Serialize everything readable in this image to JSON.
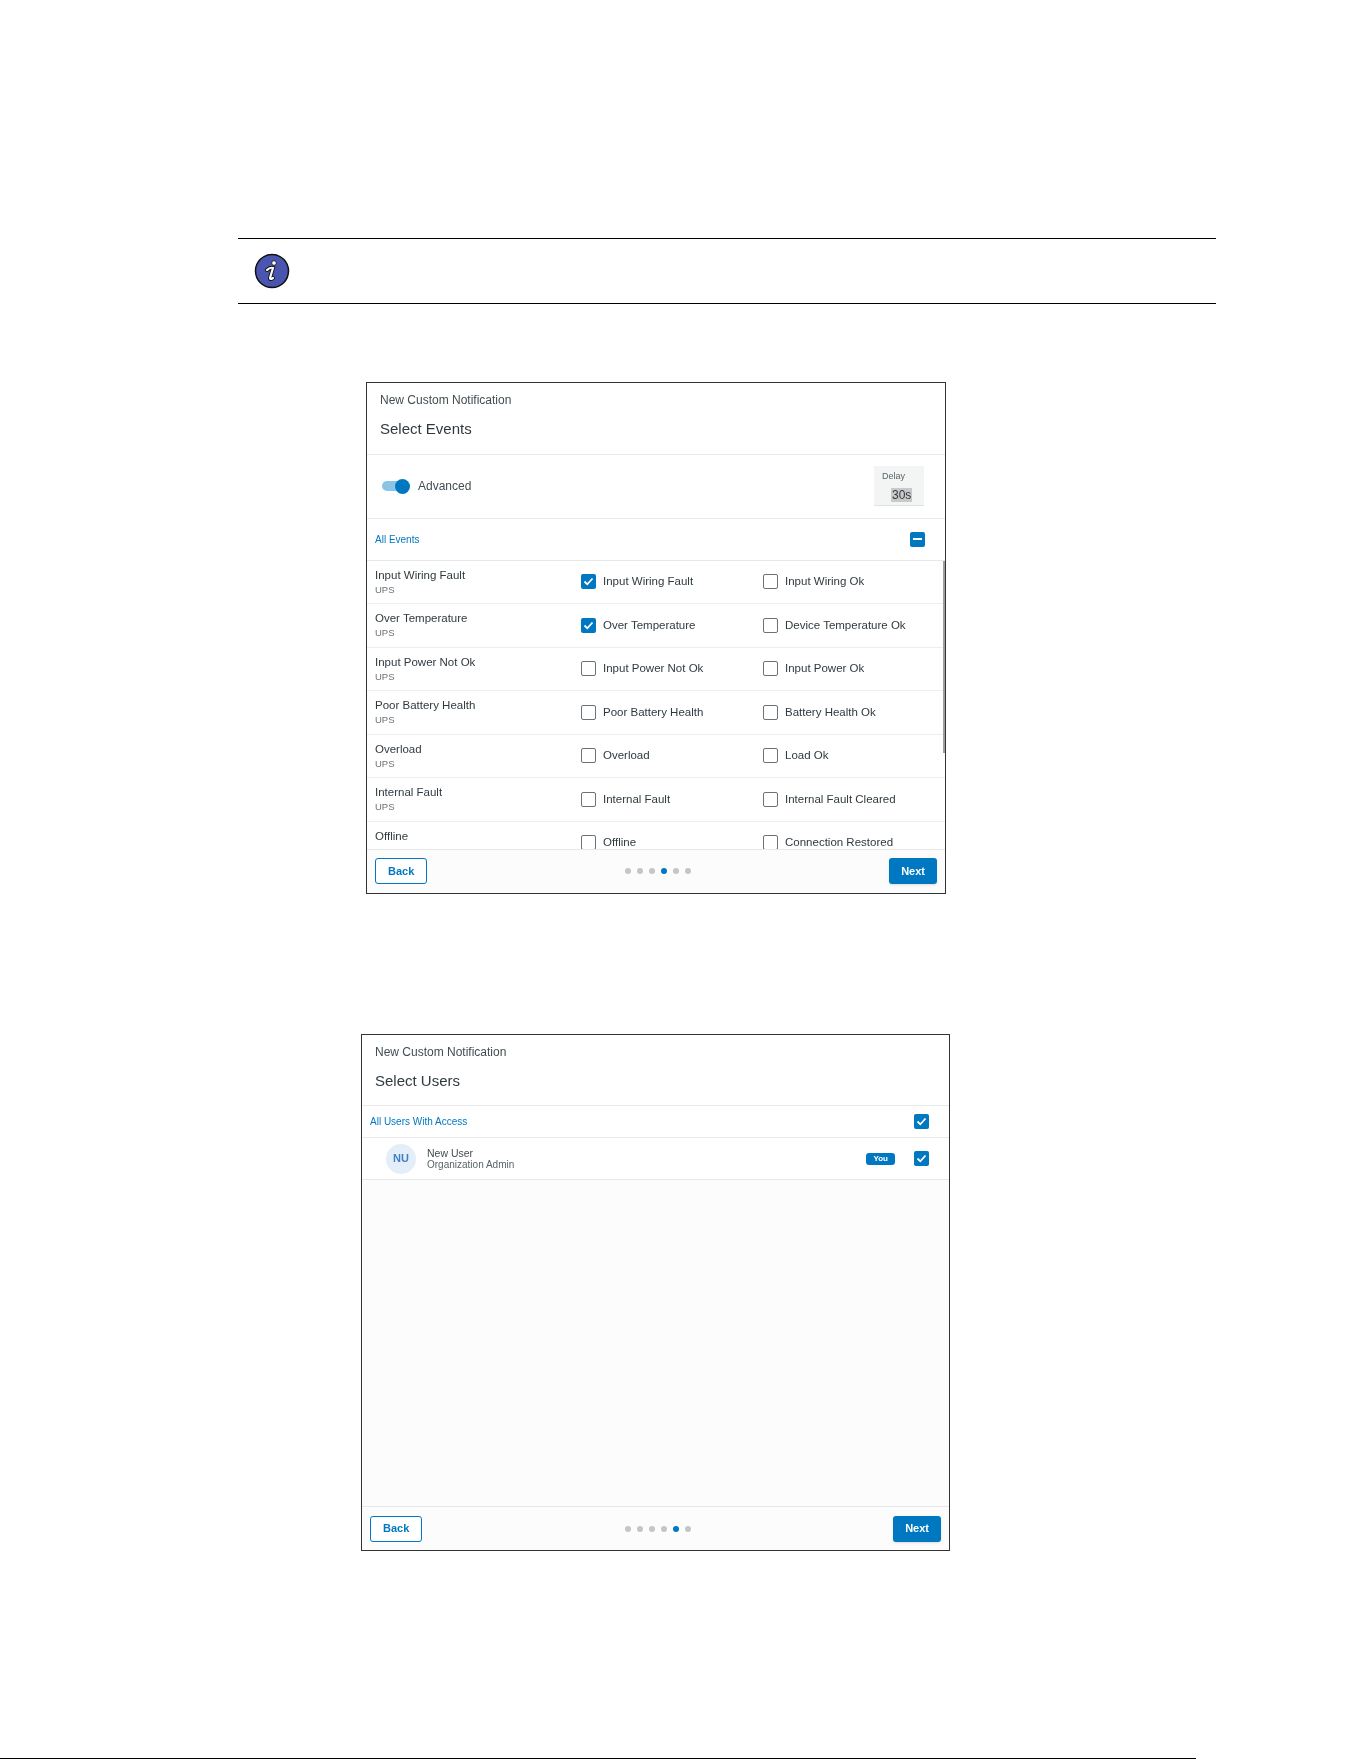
{
  "events_dialog": {
    "title": "New Custom Notification",
    "subtitle": "Select Events",
    "advanced": {
      "label": "Advanced",
      "on": true
    },
    "delay": {
      "label": "Delay",
      "value": "30s"
    },
    "all_events": {
      "label": "All Events",
      "indeterminate": true
    },
    "rows": [
      {
        "name": "Input Wiring Fault",
        "source": "UPS",
        "options": [
          {
            "label": "Input Wiring Fault",
            "checked": true
          },
          {
            "label": "Input Wiring Ok",
            "checked": false
          }
        ]
      },
      {
        "name": "Over Temperature",
        "source": "UPS",
        "options": [
          {
            "label": "Over Temperature",
            "checked": true
          },
          {
            "label": "Device Temperature Ok",
            "checked": false
          }
        ]
      },
      {
        "name": "Input Power Not Ok",
        "source": "UPS",
        "options": [
          {
            "label": "Input Power Not Ok",
            "checked": false
          },
          {
            "label": "Input Power Ok",
            "checked": false
          }
        ]
      },
      {
        "name": "Poor Battery Health",
        "source": "UPS",
        "options": [
          {
            "label": "Poor Battery Health",
            "checked": false
          },
          {
            "label": "Battery Health Ok",
            "checked": false
          }
        ]
      },
      {
        "name": "Overload",
        "source": "UPS",
        "options": [
          {
            "label": "Overload",
            "checked": false
          },
          {
            "label": "Load Ok",
            "checked": false
          }
        ]
      },
      {
        "name": "Internal Fault",
        "source": "UPS",
        "options": [
          {
            "label": "Internal Fault",
            "checked": false
          },
          {
            "label": "Internal Fault Cleared",
            "checked": false
          }
        ]
      },
      {
        "name": "Offline",
        "options": [
          {
            "label": "Offline",
            "checked": false
          },
          {
            "label": "Connection Restored",
            "checked": false
          }
        ]
      }
    ],
    "back": "Back",
    "next": "Next",
    "steps": [
      {
        "selected": false
      },
      {
        "selected": false
      },
      {
        "selected": false
      },
      {
        "selected": true
      },
      {
        "selected": false
      },
      {
        "selected": false
      }
    ]
  },
  "users_dialog": {
    "title": "New Custom Notification",
    "subtitle": "Select Users",
    "all_users": {
      "label": "All Users With Access",
      "checked": true
    },
    "users": [
      {
        "initials": "NU",
        "name": "New User",
        "role": "Organization Admin",
        "badge": "You",
        "checked": true
      }
    ],
    "back": "Back",
    "next": "Next",
    "steps": [
      {
        "selected": false
      },
      {
        "selected": false
      },
      {
        "selected": false
      },
      {
        "selected": false
      },
      {
        "selected": true
      },
      {
        "selected": false
      }
    ]
  }
}
